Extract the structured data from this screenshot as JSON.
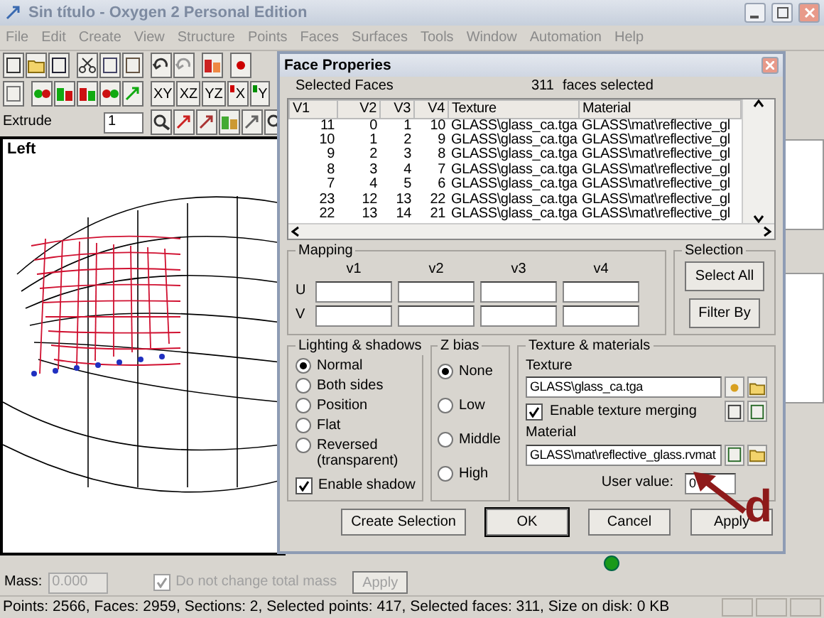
{
  "window": {
    "title": "Sin título - Oxygen 2 Personal Edition"
  },
  "menu": [
    "File",
    "Edit",
    "Create",
    "View",
    "Structure",
    "Points",
    "Faces",
    "Surfaces",
    "Tools",
    "Window",
    "Automation",
    "Help"
  ],
  "view_buttons": [
    {
      "label": "XY"
    },
    {
      "label": "XZ"
    },
    {
      "label": "YZ"
    },
    {
      "label": "X",
      "color": "#d00000"
    },
    {
      "label": "Y",
      "color": "#009000"
    }
  ],
  "extrude": {
    "label": "Extrude",
    "value": "1"
  },
  "viewport": {
    "label": "Left"
  },
  "dialog": {
    "title": "Face Properies",
    "selected_label": "Selected Faces",
    "count": "311",
    "count_text": "faces selected",
    "table": {
      "columns": [
        "V1",
        "V2",
        "V3",
        "V4",
        "Texture",
        "Material"
      ],
      "rows": [
        [
          "11",
          "0",
          "1",
          "10",
          "GLASS\\glass_ca.tga",
          "GLASS\\mat\\reflective_gl"
        ],
        [
          "10",
          "1",
          "2",
          "9",
          "GLASS\\glass_ca.tga",
          "GLASS\\mat\\reflective_gl"
        ],
        [
          "9",
          "2",
          "3",
          "8",
          "GLASS\\glass_ca.tga",
          "GLASS\\mat\\reflective_gl"
        ],
        [
          "8",
          "3",
          "4",
          "7",
          "GLASS\\glass_ca.tga",
          "GLASS\\mat\\reflective_gl"
        ],
        [
          "7",
          "4",
          "5",
          "6",
          "GLASS\\glass_ca.tga",
          "GLASS\\mat\\reflective_gl"
        ],
        [
          "23",
          "12",
          "13",
          "22",
          "GLASS\\glass_ca.tga",
          "GLASS\\mat\\reflective_gl"
        ],
        [
          "22",
          "13",
          "14",
          "21",
          "GLASS\\glass_ca.tga",
          "GLASS\\mat\\reflective_gl"
        ]
      ]
    },
    "mapping": {
      "title": "Mapping",
      "columns": [
        "v1",
        "v2",
        "v3",
        "v4"
      ],
      "rows": [
        "U",
        "V"
      ]
    },
    "selection": {
      "title": "Selection",
      "buttons": [
        "Select All",
        "Filter By"
      ]
    },
    "lighting": {
      "title": "Lighting & shadows",
      "options": [
        {
          "label": "Normal",
          "selected": true
        },
        {
          "label": "Both sides",
          "selected": false
        },
        {
          "label": "Position",
          "selected": false
        },
        {
          "label": "Flat",
          "selected": false
        },
        {
          "label": "Reversed (transparent)",
          "selected": false
        }
      ],
      "enable_shadow": {
        "label": "Enable shadow",
        "checked": true
      }
    },
    "z_bias": {
      "title": "Z bias",
      "options": [
        {
          "label": "None",
          "selected": true
        },
        {
          "label": "Low",
          "selected": false
        },
        {
          "label": "Middle",
          "selected": false
        },
        {
          "label": "High",
          "selected": false
        }
      ]
    },
    "texture": {
      "title": "Texture & materials",
      "texture_label": "Texture",
      "texture_value": "GLASS\\glass_ca.tga",
      "merging": {
        "label": "Enable texture merging",
        "checked": true
      },
      "material_label": "Material",
      "material_value": "GLASS\\mat\\reflective_glass.rvmat",
      "user_label": "User value:",
      "user_value": "0"
    },
    "buttons": [
      {
        "label": "Create Selection",
        "default": false
      },
      {
        "label": "OK",
        "default": true
      },
      {
        "label": "Cancel",
        "default": false
      },
      {
        "label": "Apply",
        "default": false
      }
    ]
  },
  "annotation": {
    "letter": "d"
  },
  "mass": {
    "label": "Mass:",
    "value": "0.000",
    "disabled": true,
    "checkbox": {
      "label": "Do not change total mass",
      "checked": true,
      "disabled": true
    },
    "apply": {
      "label": "Apply",
      "disabled": true
    }
  },
  "status_bar": {
    "text": "Points: 2566, Faces: 2959, Sections: 2, Selected points: 417, Selected faces: 311, Size on disk: 0 KB"
  }
}
